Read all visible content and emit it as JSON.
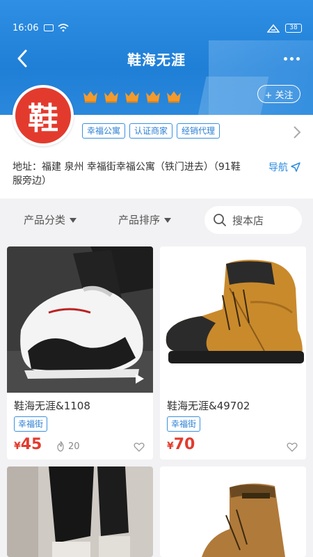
{
  "status": {
    "time": "16:06",
    "battery": "38"
  },
  "header": {
    "title": "鞋海无涯"
  },
  "shop": {
    "avatar_char": "鞋",
    "follow_label": "+ 关注",
    "tags": [
      "幸福公寓",
      "认证商家",
      "经销代理"
    ],
    "address": "地址：福建 泉州 幸福街幸福公寓（铁门进去）（91鞋服旁边）",
    "nav_label": "导航"
  },
  "filters": {
    "category_label": "产品分类",
    "sort_label": "产品排序",
    "search_placeholder": "搜本店"
  },
  "products": [
    {
      "title": "鞋海无涯&1108",
      "tag": "幸福街",
      "currency": "¥",
      "price": "45",
      "views": "20"
    },
    {
      "title": "鞋海无涯&49702",
      "tag": "幸福街",
      "currency": "¥",
      "price": "70"
    }
  ],
  "icons": {
    "back": "chevron-left-icon",
    "more": "more-dots-icon",
    "crown": "crown-icon",
    "chevron": "chevron-right-icon",
    "navigate": "navigate-arrow-icon",
    "search": "search-icon",
    "flame": "flame-icon",
    "heart": "heart-icon",
    "play": "play-icon"
  },
  "colors": {
    "primary": "#2b8be0",
    "accent_red": "#e23b2e",
    "crown": "#f39a2c"
  }
}
